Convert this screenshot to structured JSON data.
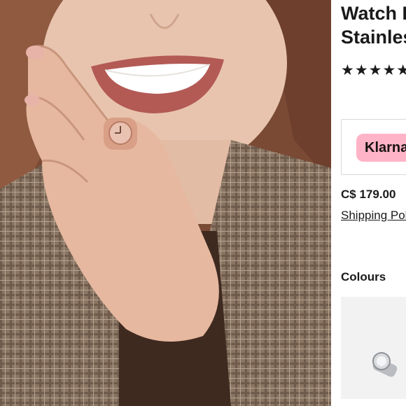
{
  "product": {
    "title_line1": "Watch Ring",
    "title_line2": "Stainless Steel",
    "rating_stars": "★★★★★",
    "payment_provider": "Klarna.",
    "price": "C$ 179.00",
    "shipping_link": "Shipping Policy",
    "colours_label": "Colours"
  },
  "icons": {
    "rating": "star-icon",
    "swatch": "silver-watch-ring-thumbnail"
  },
  "colors": {
    "klarna_pink": "#ffb3c7",
    "text": "#1a1a1a",
    "ring_rose_gold": "#d9a087"
  }
}
